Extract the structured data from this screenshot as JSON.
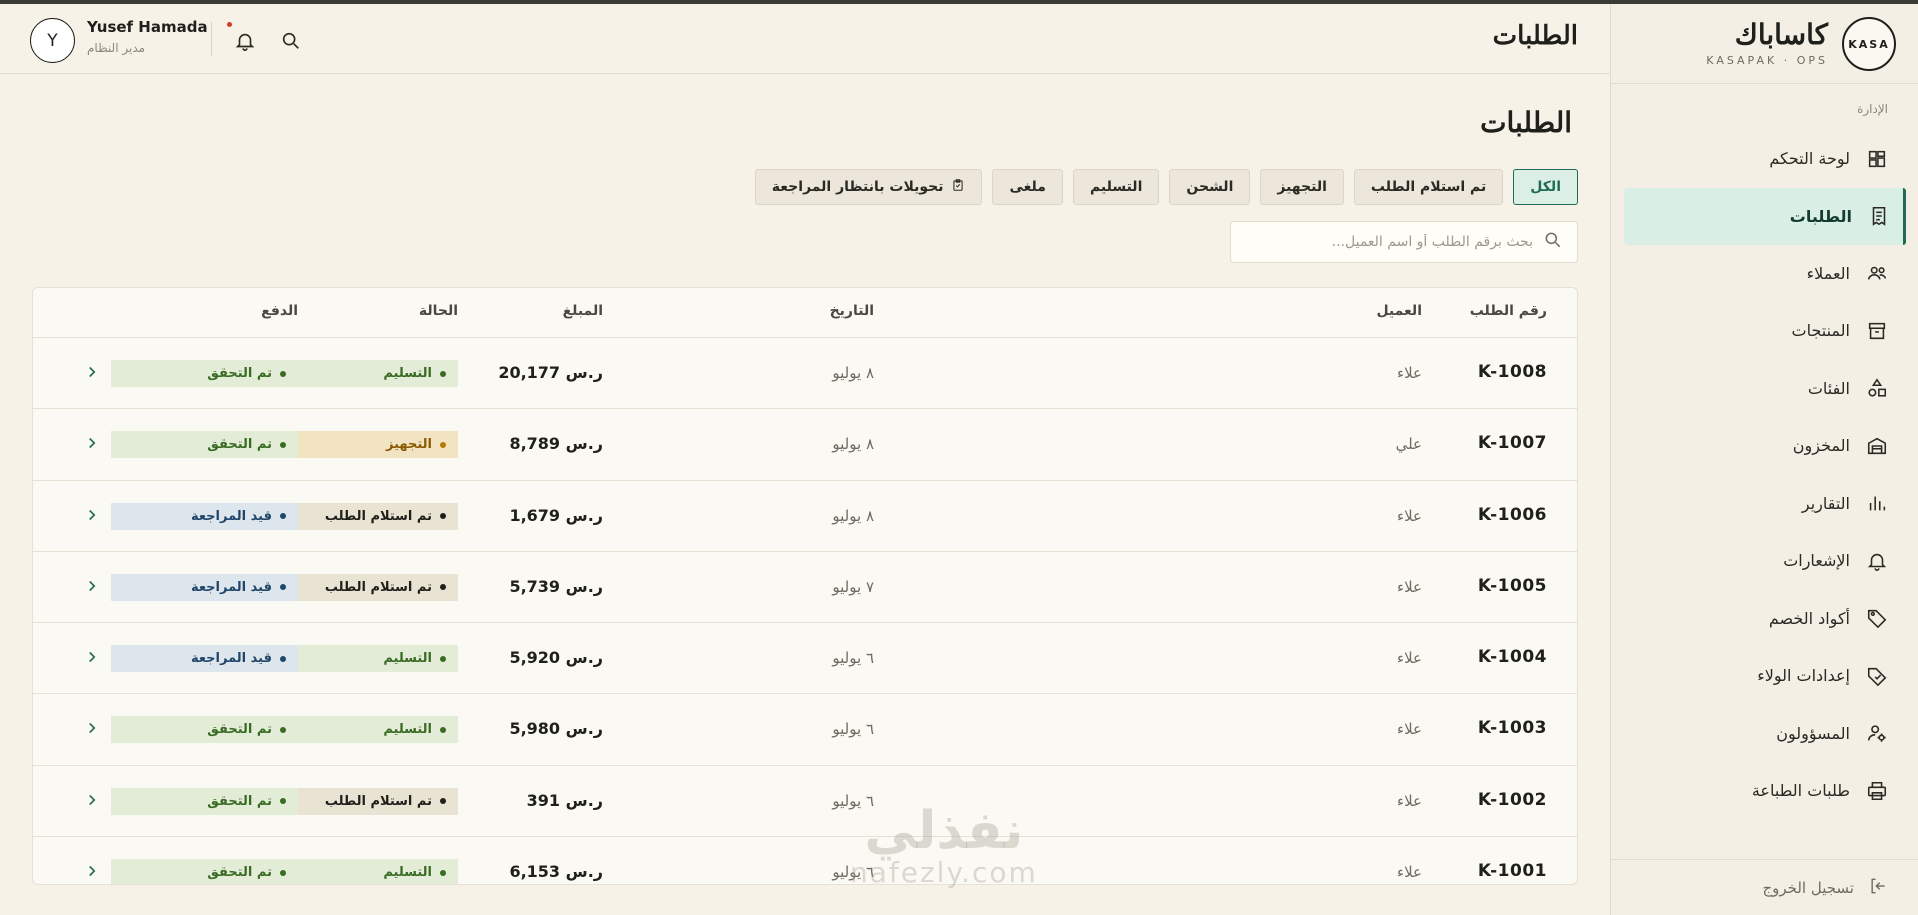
{
  "brand": {
    "badge": "KASA",
    "name": "كاساباك",
    "sub": "KASAPAK · OPS"
  },
  "topbar": {
    "title": "الطلبات",
    "user_name": "Yusef Hamada",
    "user_role": "مدير النظام",
    "avatar_letter": "Y"
  },
  "sidebar": {
    "section": "الإدارة",
    "items": [
      {
        "label": "لوحة التحكم",
        "icon": "dashboard-icon"
      },
      {
        "label": "الطلبات",
        "icon": "orders-icon",
        "active": true
      },
      {
        "label": "العملاء",
        "icon": "users-icon"
      },
      {
        "label": "المنتجات",
        "icon": "box-icon"
      },
      {
        "label": "الفئات",
        "icon": "shapes-icon"
      },
      {
        "label": "المخزون",
        "icon": "warehouse-icon"
      },
      {
        "label": "التقارير",
        "icon": "chart-icon"
      },
      {
        "label": "الإشعارات",
        "icon": "bell-icon"
      },
      {
        "label": "أكواد الخصم",
        "icon": "tag-icon"
      },
      {
        "label": "إعدادات الولاء",
        "icon": "loyalty-tag-icon"
      },
      {
        "label": "المسؤولون",
        "icon": "admin-icon"
      },
      {
        "label": "طلبات الطباعة",
        "icon": "printer-icon"
      }
    ],
    "logout": "تسجيل الخروج"
  },
  "main": {
    "title": "الطلبات",
    "filters": [
      "الكل",
      "تم استلام الطلب",
      "التجهيز",
      "الشحن",
      "التسليم",
      "ملغى",
      "تحويلات بانتظار المراجعة"
    ],
    "search_placeholder": "بحث برقم الطلب أو اسم العميل..."
  },
  "table": {
    "headers": {
      "id": "رقم الطلب",
      "customer": "العميل",
      "date": "التاريخ",
      "amount": "المبلغ",
      "status": "الحالة",
      "payment": "الدفع"
    },
    "rows": [
      {
        "id": "K-1008",
        "customer": "علاء",
        "date": "٨ يوليو",
        "amount": "20,177 ر.س",
        "status": "التسليم",
        "payment": "تم التحقق"
      },
      {
        "id": "K-1007",
        "customer": "علي",
        "date": "٨ يوليو",
        "amount": "8,789 ر.س",
        "status": "التجهيز",
        "payment": "تم التحقق"
      },
      {
        "id": "K-1006",
        "customer": "علاء",
        "date": "٨ يوليو",
        "amount": "1,679 ر.س",
        "status": "تم استلام الطلب",
        "payment": "قيد المراجعة"
      },
      {
        "id": "K-1005",
        "customer": "علاء",
        "date": "٧ يوليو",
        "amount": "5,739 ر.س",
        "status": "تم استلام الطلب",
        "payment": "قيد المراجعة"
      },
      {
        "id": "K-1004",
        "customer": "علاء",
        "date": "٦ يوليو",
        "amount": "5,920 ر.س",
        "status": "التسليم",
        "payment": "قيد المراجعة"
      },
      {
        "id": "K-1003",
        "customer": "علاء",
        "date": "٦ يوليو",
        "amount": "5,980 ر.س",
        "status": "التسليم",
        "payment": "تم التحقق"
      },
      {
        "id": "K-1002",
        "customer": "علاء",
        "date": "٦ يوليو",
        "amount": "391 ر.س",
        "status": "تم استلام الطلب",
        "payment": "تم التحقق"
      },
      {
        "id": "K-1001",
        "customer": "علاء",
        "date": "٦ يوليو",
        "amount": "6,153 ر.س",
        "status": "التسليم",
        "payment": "تم التحقق"
      }
    ]
  },
  "watermark": {
    "ar": "نفذلي",
    "en": "nafezly.com"
  }
}
